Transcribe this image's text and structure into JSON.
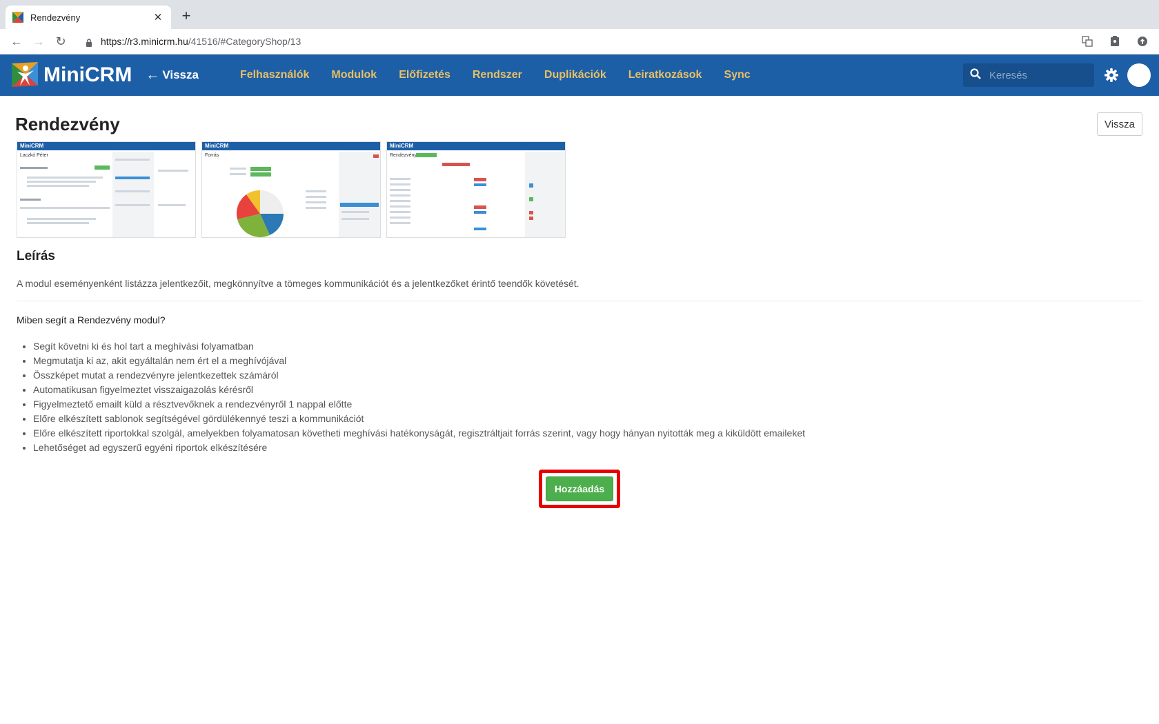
{
  "browser": {
    "tab_title": "Rendezvény",
    "url_host": "https://r3.minicrm.hu",
    "url_path": "/41516/#CategoryShop/13"
  },
  "app": {
    "logo_text": "MiniCRM",
    "back_label": "Vissza",
    "nav": [
      "Felhasználók",
      "Modulok",
      "Előfizetés",
      "Rendszer",
      "Duplikációk",
      "Leiratkozások",
      "Sync"
    ],
    "search_placeholder": "Keresés"
  },
  "page": {
    "title": "Rendezvény",
    "back_button": "Vissza",
    "section_title": "Leírás",
    "description": "A modul eseményenként listázza jelentkezőit, megkönnyítve a tömeges kommunikációt és a jelentkezőket érintő teendők követését.",
    "question": "Miben segít a Rendezvény modul?",
    "benefits": [
      "Segít követni ki és hol tart a meghívási folyamatban",
      "Megmutatja ki az, akit egyáltalán nem ért el a meghívójával",
      "Összképet mutat a rendezvényre jelentkezettek számáról",
      "Automatikusan figyelmeztet visszaigazolás kérésről",
      "Figyelmeztető emailt küld a résztvevőknek a rendezvényről 1 nappal előtte",
      "Előre elkészített sablonok segítségével gördülékennyé teszi a kommunikációt",
      "Előre elkészített riportokkal szolgál, amelyekben folyamatosan követheti meghívási hatékonyságát, regisztráltjait forrás szerint, vagy hogy hányan nyitották meg a kiküldött emaileket",
      "Lehetőséget ad egyszerű egyéni riportok elkészítésére"
    ],
    "add_button": "Hozzáadás"
  },
  "thumbnails": [
    {
      "logo": "MiniCRM",
      "title": "Laczkó Péter"
    },
    {
      "logo": "MiniCRM",
      "title": "Forrás"
    },
    {
      "logo": "MiniCRM",
      "title": "Rendezvény"
    }
  ],
  "colors": {
    "header_bg": "#1d5fa6",
    "nav_text": "#e8c064",
    "add_button": "#4cae4c",
    "highlight": "#e60000"
  }
}
